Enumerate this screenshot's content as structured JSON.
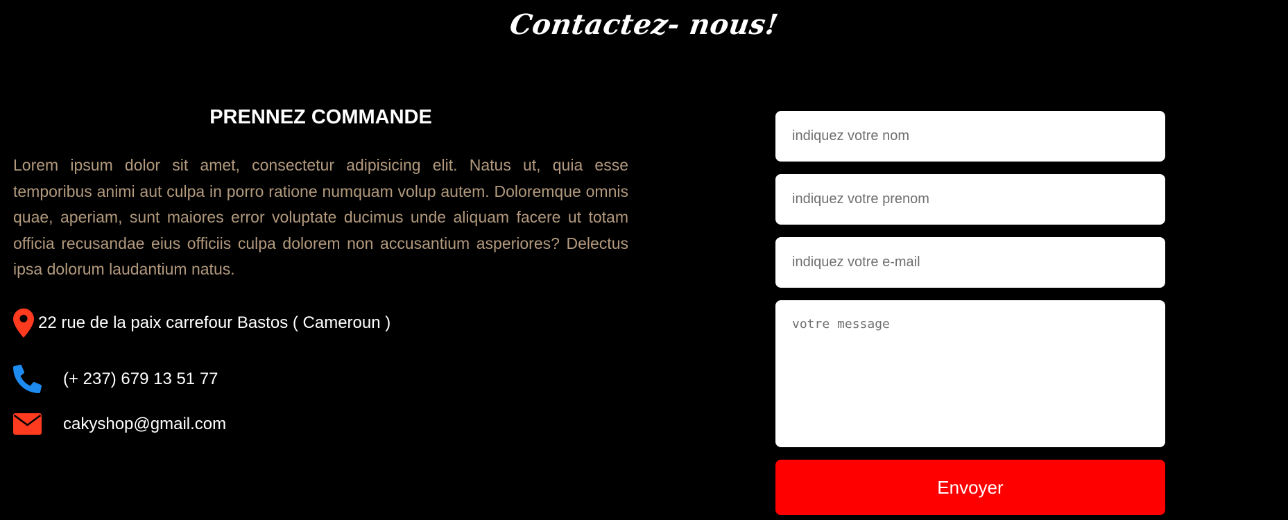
{
  "header": {
    "title": "Contactez- nous!"
  },
  "info": {
    "heading": "PRENNEZ COMMANDE",
    "description": "Lorem ipsum dolor sit amet, consectetur adipisicing elit. Natus ut, quia esse temporibus animi aut culpa in porro ratione numquam volup autem. Doloremque omnis quae, aperiam, sunt maiores error voluptate ducimus unde aliquam facere ut totam officia recusandae eius officiis culpa dolorem non accusantium asperiores? Delectus ipsa dolorum laudantium natus.",
    "address": "22 rue de la paix carrefour Bastos ( Cameroun )",
    "phone": "(+ 237) 679 13 51 77",
    "email": "cakyshop@gmail.com"
  },
  "icons": {
    "address": "map-marker-icon",
    "phone": "phone-icon",
    "email": "envelope-icon"
  },
  "colors": {
    "background": "#000000",
    "accent": "#ff0000",
    "phone_icon": "#1e8bf0",
    "marker_icon": "#ff3b1f",
    "body_text": "#b39a7e"
  },
  "form": {
    "name_placeholder": "indiquez votre nom",
    "name_value": "",
    "firstname_placeholder": "indiquez votre prenom",
    "firstname_value": "",
    "email_placeholder": "indiquez votre e-mail",
    "email_value": "",
    "message_placeholder": "votre message",
    "message_value": "",
    "submit_label": "Envoyer"
  }
}
